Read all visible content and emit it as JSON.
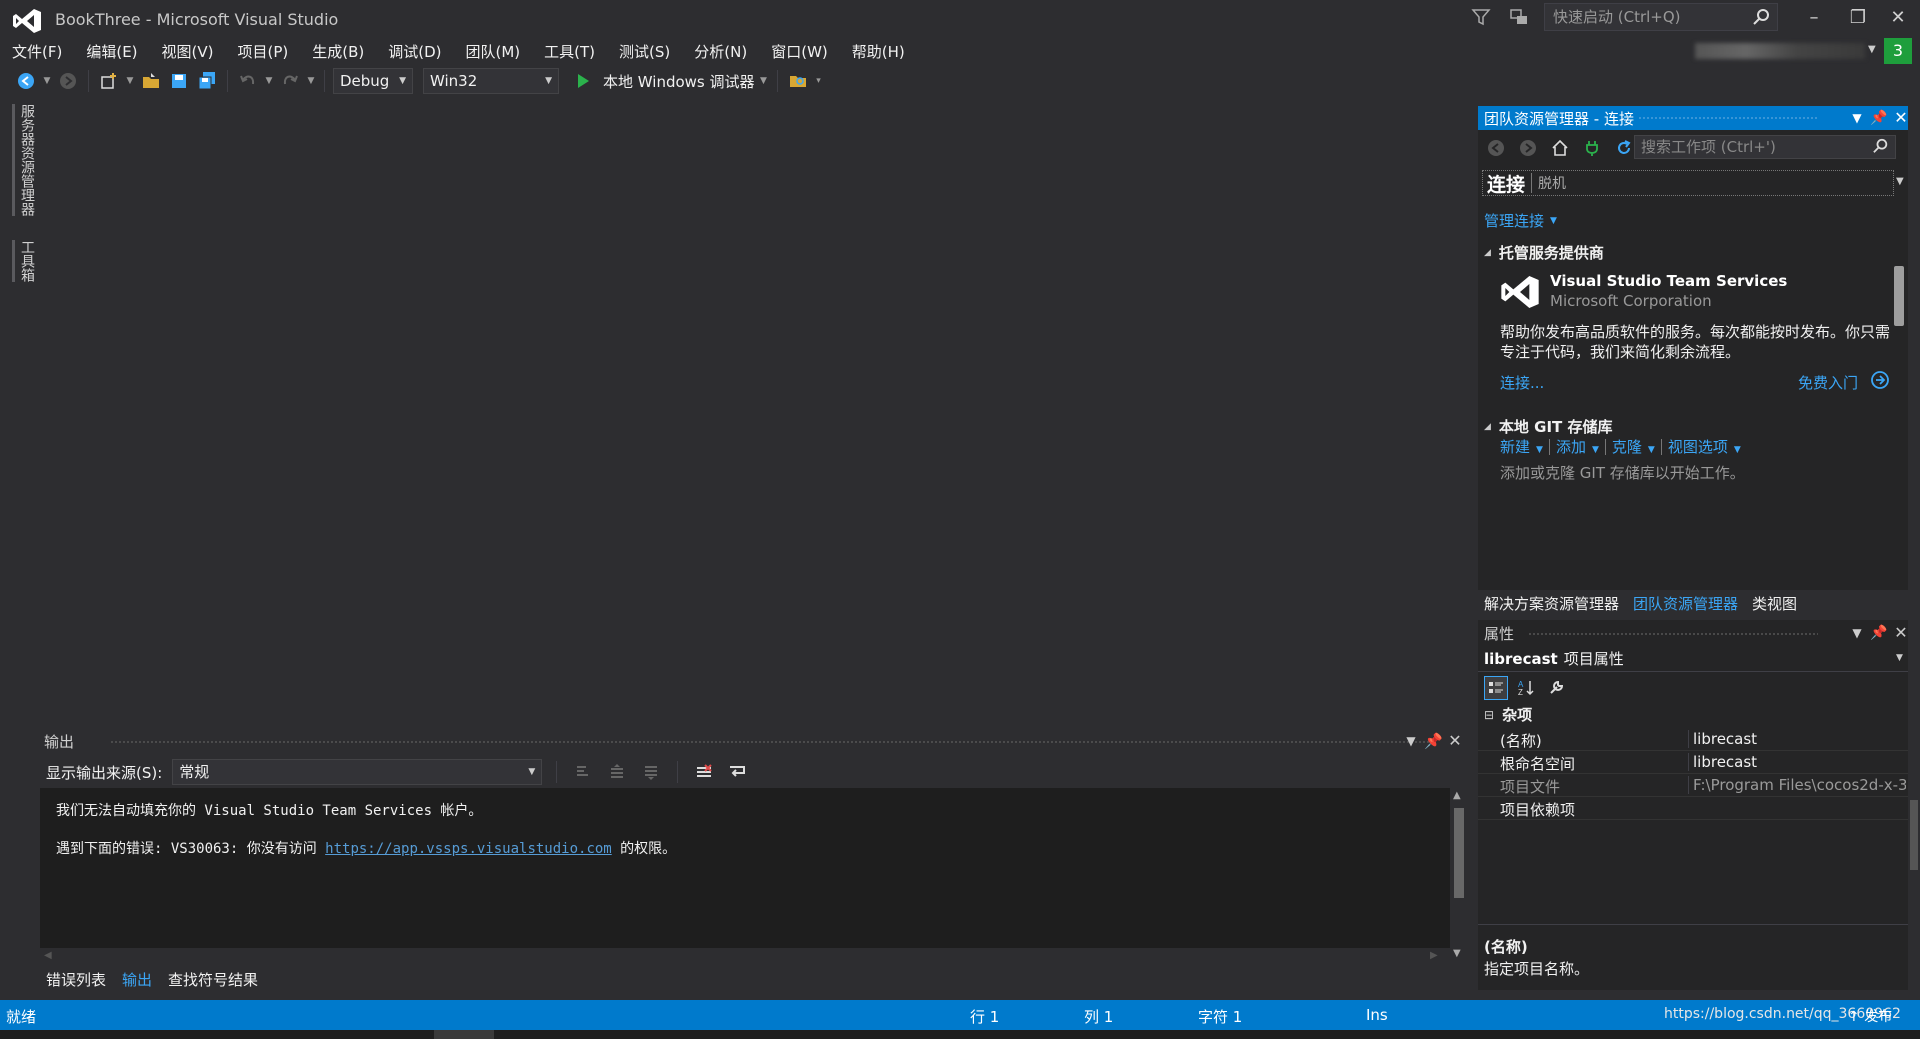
{
  "window": {
    "title": "BookThree - Microsoft Visual Studio",
    "quick_launch_placeholder": "快速启动 (Ctrl+Q)",
    "notification_count": "3"
  },
  "menu": [
    "文件(F)",
    "编辑(E)",
    "视图(V)",
    "项目(P)",
    "生成(B)",
    "调试(D)",
    "团队(M)",
    "工具(T)",
    "测试(S)",
    "分析(N)",
    "窗口(W)",
    "帮助(H)"
  ],
  "toolbar": {
    "configuration": "Debug",
    "platform": "Win32",
    "run_label": "本地 Windows 调试器"
  },
  "left_tabs": [
    "服务器资源管理器",
    "工具箱"
  ],
  "output": {
    "title": "输出",
    "source_label": "显示输出来源(S):",
    "source_value": "常规",
    "line1": "我们无法自动填充你的 Visual Studio Team Services 帐户。",
    "line2_prefix": "遇到下面的错误: VS30063: 你没有访问 ",
    "line2_link": "https://app.vssps.visualstudio.com",
    "line2_suffix": " 的权限。",
    "tabs": [
      "错误列表",
      "输出",
      "查找符号结果"
    ]
  },
  "team_explorer": {
    "title": "团队资源管理器 - 连接",
    "search_placeholder": "搜索工作项 (Ctrl+')",
    "section": "连接",
    "status": "脱机",
    "manage_link": "管理连接",
    "hosted_title": "托管服务提供商",
    "vsts_name": "Visual Studio Team Services",
    "vsts_corp": "Microsoft Corporation",
    "vsts_desc": "帮助你发布高品质软件的服务。每次都能按时发布。你只需专注于代码，我们来简化剩余流程。",
    "vsts_connect": "连接...",
    "vsts_free": "免费入门",
    "git_title": "本地 GIT 存储库",
    "git_actions": [
      "新建",
      "添加",
      "克隆",
      "视图选项"
    ],
    "git_empty": "添加或克隆 GIT 存储库以开始工作。"
  },
  "right_tabs": [
    "解决方案资源管理器",
    "团队资源管理器",
    "类视图"
  ],
  "properties": {
    "title": "属性",
    "object_name": "librecast",
    "object_type": "项目属性",
    "category": "杂项",
    "rows": [
      {
        "name": "(名称)",
        "value": "librecast"
      },
      {
        "name": "根命名空间",
        "value": "librecast"
      },
      {
        "name": "项目文件",
        "value": "F:\\Program Files\\cocos2d-x-3."
      },
      {
        "name": "项目依赖项",
        "value": ""
      }
    ],
    "desc_title": "(名称)",
    "desc_text": "指定项目名称。"
  },
  "status": {
    "ready": "就绪",
    "line": "行 1",
    "col": "列 1",
    "char": "字符 1",
    "ins": "Ins",
    "url_watermark": "https://blog.csdn.net/qq_3660962",
    "publish": "发布"
  },
  "colors": {
    "accent": "#007acc",
    "link": "#3ba6f6",
    "background": "#2d2d30",
    "badge": "#1e9e3c"
  }
}
